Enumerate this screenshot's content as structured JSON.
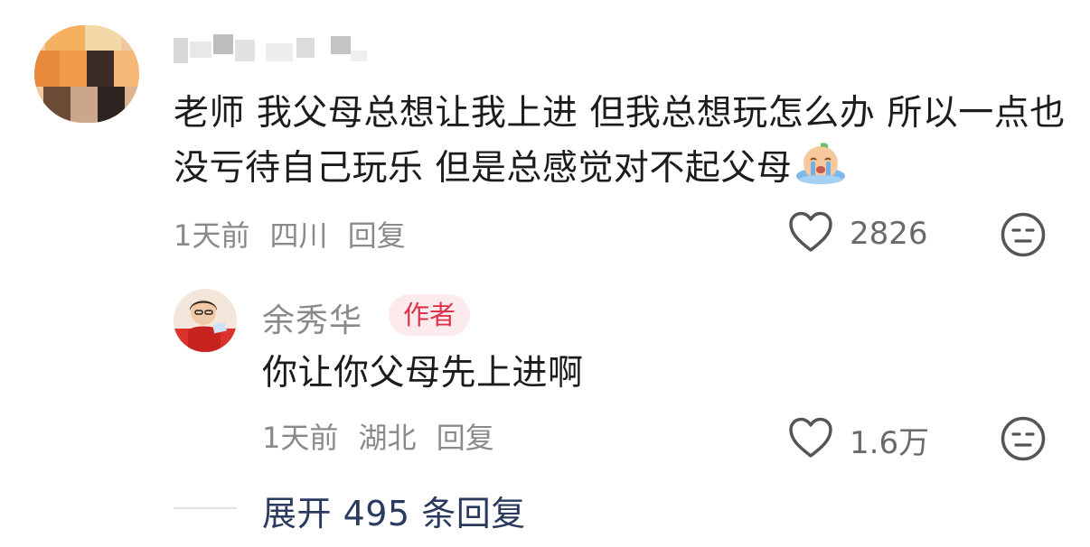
{
  "comment": {
    "text": "老师 我父母总想让我上进 但我总想玩怎么办 所以一点也没亏待自己玩乐 但是总感觉对不起父母",
    "emoji": "crying-face-emoji",
    "time": "1天前",
    "location": "四川",
    "reply_label": "回复",
    "likes": "2826"
  },
  "reply": {
    "author": "余秀华",
    "badge": "作者",
    "text": "你让你父母先上进啊",
    "time": "1天前",
    "location": "湖北",
    "reply_label": "回复",
    "likes": "1.6万"
  },
  "expand": {
    "label": "展开 495 条回复"
  },
  "icons": {
    "like": "heart-outline-icon",
    "dislike": "meh-face-icon"
  },
  "colors": {
    "text": "#1c1c1c",
    "meta": "#8a8a8a",
    "badge_text": "#e0314b",
    "badge_bg": "#fdeaec",
    "expand_link": "#2a3a5e"
  }
}
